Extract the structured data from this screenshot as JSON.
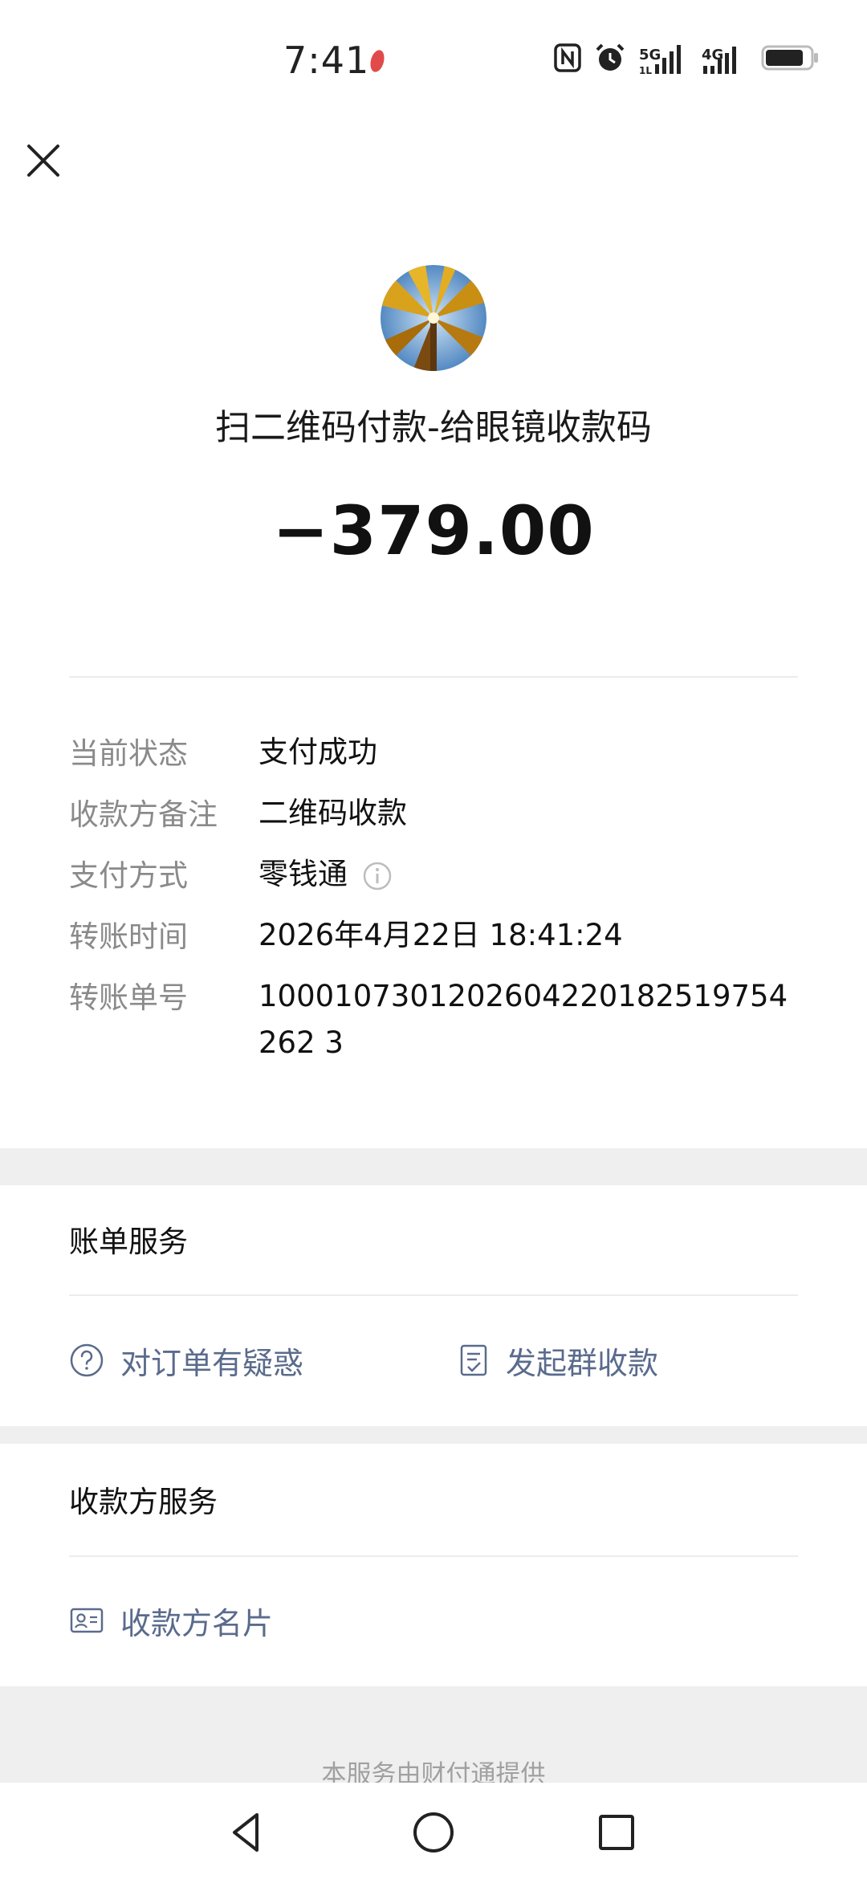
{
  "status_bar": {
    "time": "7:41",
    "signal_1_label": "5G",
    "signal_2_label": "4G",
    "icons": [
      "nfc-icon",
      "alarm-icon",
      "signal-5g-icon",
      "signal-4g-icon",
      "battery-icon"
    ]
  },
  "header": {
    "merchant_title": "扫二维码付款-给眼镜收款码",
    "amount": "−379.00"
  },
  "details": [
    {
      "label": "当前状态",
      "value": "支付成功"
    },
    {
      "label": "收款方备注",
      "value": "二维码收款"
    },
    {
      "label": "支付方式",
      "value": "零钱通"
    },
    {
      "label": "转账时间",
      "value": "2026年4月22日 18:41:24"
    },
    {
      "label": "转账单号",
      "value": "1000107301202604220182519754262 3"
    }
  ],
  "bill_service": {
    "title": "账单服务",
    "actions": [
      {
        "label": "对订单有疑惑",
        "icon": "question-circle-icon"
      },
      {
        "label": "发起群收款",
        "icon": "checklist-icon"
      }
    ]
  },
  "payee_service": {
    "title": "收款方服务",
    "actions": [
      {
        "label": "收款方名片",
        "icon": "contact-card-icon"
      }
    ]
  },
  "footer": {
    "provider_text": "本服务由财付通提供"
  },
  "colors": {
    "link": "#5a6b8c",
    "label_gray": "#8a8a8a",
    "band_gray": "#efefef"
  }
}
